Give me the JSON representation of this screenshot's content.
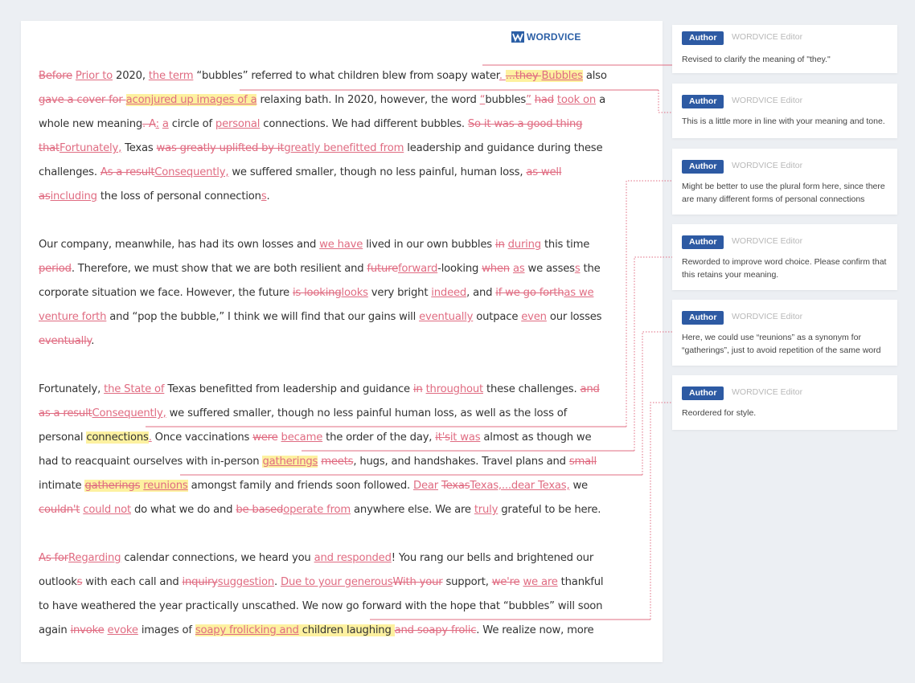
{
  "logo": {
    "text": "WORDVICE"
  },
  "doc": {
    "p1": {
      "l1": {
        "d1": "Before",
        "s1": " ",
        "i1": "Prior to",
        "t1": " 2020, ",
        "i2": "the term",
        "t2": " “bubbles” referred to what children blew from soapy water",
        "i3": ". ",
        "d2": "...they ",
        "i4": "Bubbles",
        "t3": " also"
      },
      "l2": {
        "d1": "gave a cover for ",
        "i1": "a",
        "i2": "conjured up images of a",
        "t1": " relaxing bath. In 2020, however, the word ",
        "i3": "“",
        "t2": "bubbles",
        "i4": "”",
        "s1": " ",
        "d2": "had",
        "s2": " ",
        "i5": "took on",
        "t3": " a"
      },
      "l3": {
        "t1": "whole new meaning",
        "d1": ". A",
        "i1": ":",
        "s1": " ",
        "i2": "a",
        "t2": " circle of ",
        "i3": "personal",
        "t3": " connections. We had different bubbles. ",
        "d2": "So it was a good thing"
      },
      "l4": {
        "d1": "that",
        "i1": "Fortunately,",
        "t1": " Texas ",
        "d2": "was greatly uplifted by it",
        "i2": "greatly benefitted from",
        "t2": " leadership and guidance during these"
      },
      "l5": {
        "t1": "challenges. ",
        "d1": "As a result",
        "i1": "Consequently,",
        "t2": " we suffered smaller, though no less painful, human loss, ",
        "d2": "as well"
      },
      "l6": {
        "d1": "as",
        "i1": "including",
        "t1": " the loss of personal connection",
        "i2": "s",
        "t2": "."
      }
    },
    "p2": {
      "l1": {
        "t1": "Our company, meanwhile, has had its own losses and ",
        "i1": "we have",
        "t2": " lived in our own bubbles ",
        "d1": "in",
        "s1": " ",
        "i2": "during",
        "t3": " this time"
      },
      "l2": {
        "d1": "period",
        "t1": ". Therefore, we must show that we are both resilient and ",
        "d2": "future",
        "i1": "forward",
        "t2": "-looking ",
        "d3": "when",
        "s1": " ",
        "i2": "as",
        "t3": " we asses",
        "i3": "s",
        "t4": " the"
      },
      "l3": {
        "t1": "corporate situation we face. However, the future ",
        "d1": "is looking",
        "i1": "looks",
        "t2": " very bright ",
        "i2": "indeed",
        "t3": ", and ",
        "d2": "if we go forth",
        "i3": "as we"
      },
      "l4": {
        "i1": "venture forth",
        "t1": " and “pop the bubble,” I think we will find that our gains will ",
        "i2": "eventually",
        "t2": " outpace ",
        "i3": "even",
        "t3": " our losses"
      },
      "l5": {
        "d1": "eventually",
        "t1": "."
      }
    },
    "p3": {
      "l1": {
        "t1": "Fortunately, ",
        "i1": "the State of",
        "t2": " Texas benefitted from leadership and guidance ",
        "d1": "in",
        "s1": " ",
        "i2": "throughout",
        "t3": " these challenges. ",
        "d2": "and"
      },
      "l2": {
        "d1": "as a result",
        "i1": "Consequently,",
        "t1": " we suffered smaller, though no less painful human loss, as well as the loss of"
      },
      "l3": {
        "t1": "personal ",
        "h1": "connections",
        "i1": ".",
        "t2": "  Once vaccinations ",
        "d1": "were",
        "s1": " ",
        "i2": "became",
        "t3": " the order of the day, ",
        "i3": " ",
        "d2": "it's",
        "i4": "it was",
        "t4": " almost as though we"
      },
      "l4": {
        "t1": "had to reacquaint ourselves with in-person ",
        "i1": "gatherings",
        "s1": " ",
        "d1": "meets",
        "t2": ", hugs, and handshakes. Travel plans and ",
        "d2": "small"
      },
      "l5": {
        "t1": "intimate ",
        "d1": "gatherings",
        "s1": " ",
        "i1": "reunions",
        "t2": "  amongst family and friends soon followed. ",
        "i2": "Dear",
        "s2": " ",
        "d2": "Texas",
        "i3": "Texas,...dear Texas,",
        "t3": "  we"
      },
      "l6": {
        "d1": "couldn't",
        "s1": " ",
        "i1": "could not",
        "t1": " do what we do and ",
        "d2": "be based",
        "i2": "operate from",
        "t2": " anywhere else. We are ",
        "i3": "truly",
        "t3": " grateful to be here."
      }
    },
    "p4": {
      "l1": {
        "d1": "As for",
        "i1": "Regarding",
        "t1": " calendar connections, we heard you ",
        "i2": "and responded",
        "t2": "! You rang our bells and brightened our"
      },
      "l2": {
        "t1": "outlook",
        "d1": "s",
        "t2": " with each call and ",
        "d2": "inquiry",
        "i1": "suggestion",
        "t3": ". ",
        "i2": "Due to your generous",
        "d3": "With your",
        "t4": " support, ",
        "d4": "we're",
        "s1": " ",
        "i3": "we are",
        "t5": " thankful"
      },
      "l3": {
        "t1": "to have weathered the year practically unscathed. We now go forward with the hope that “bubbles” will soon"
      },
      "l4": {
        "t1": "again ",
        "d1": "invoke",
        "s1": " ",
        "i1": "evoke",
        "t2": " images of ",
        "i2": "soapy frolicking and",
        "h1": " children laughing ",
        "d2": " and soapy frolic",
        "t3": ". We realize now, more"
      }
    }
  },
  "comments": [
    {
      "badge": "Author",
      "editor": "WORDVICE Editor",
      "text": "Revised to clarify the meaning of \"they.\""
    },
    {
      "badge": "Author",
      "editor": "WORDVICE Editor",
      "text": "This is a little more in line with your meaning and tone."
    },
    {
      "badge": "Author",
      "editor": "WORDVICE Editor",
      "text": "Might be better to use the plural form here, since there are many different forms of personal connections"
    },
    {
      "badge": "Author",
      "editor": "WORDVICE Editor",
      "text": "Reworded to improve word choice. Please confirm that this retains your meaning."
    },
    {
      "badge": "Author",
      "editor": "WORDVICE Editor",
      "text": "Here, we could use “reunions” as a synonym for “gatherings”, just to avoid repetition of the same word"
    },
    {
      "badge": "Author",
      "editor": "WORDVICE Editor",
      "text": "Reordered for style."
    }
  ]
}
